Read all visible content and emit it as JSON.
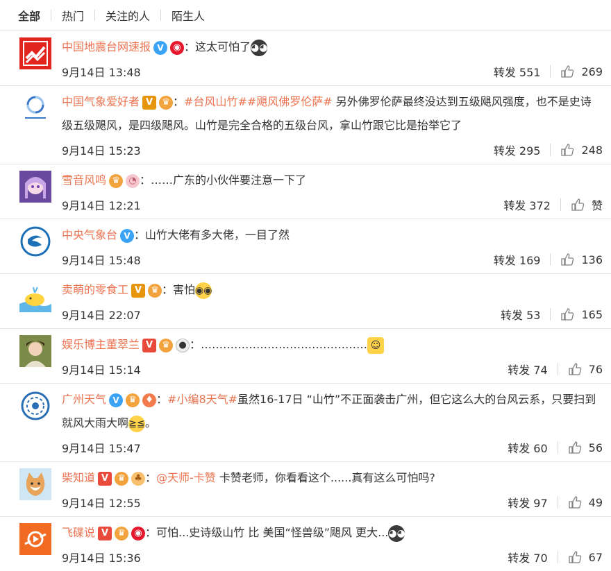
{
  "tabs": [
    "全部",
    "热门",
    "关注的人",
    "陌生人"
  ],
  "comments": [
    {
      "user": "中国地震台网速报",
      "text": "这太可怕了",
      "time": "9月14日 13:48",
      "repost": "转发 551",
      "likes": "269"
    },
    {
      "user": "中国气象爱好者",
      "tag1": "#台风山竹#",
      "tag2": "#飓风佛罗伦萨#",
      "text": " 另外佛罗伦萨最终没达到五级飓风强度，也不是史诗级五级飓风，是四级飓风。山竹是完全合格的五级台风，拿山竹跟它比是抬举它了",
      "time": "9月14日 15:23",
      "repost": "转发 295",
      "likes": "248"
    },
    {
      "user": "雪音风鸣",
      "text": "……广东的小伙伴要注意一下了",
      "time": "9月14日 12:21",
      "repost": "转发 372",
      "likes": "赞"
    },
    {
      "user": "中央气象台",
      "text": "山竹大佬有多大佬，一目了然",
      "time": "9月14日 15:48",
      "repost": "转发 169",
      "likes": "136"
    },
    {
      "user": "卖萌的零食工",
      "text": "害怕",
      "time": "9月14日 22:07",
      "repost": "转发 53",
      "likes": "165"
    },
    {
      "user": "娱乐博主董翠兰",
      "text": "………………………………………",
      "time": "9月14日 15:14",
      "repost": "转发 74",
      "likes": "76"
    },
    {
      "user": "广州天气",
      "tag1": "#小编8天气#",
      "text": "虽然16-17日 “山竹”不正面袭击广州，但它这么大的台风云系，只要扫到就风大雨大啊",
      "text_end": "。",
      "time": "9月14日 15:47",
      "repost": "转发 60",
      "likes": "56"
    },
    {
      "user": "柴知道",
      "mention": "@天师-卡赞",
      "text": " 卡赞老师，你看看这个......真有这么可怕吗?",
      "time": "9月14日 12:55",
      "repost": "转发 97",
      "likes": "49"
    },
    {
      "user": "飞碟说",
      "text": "可怕...史诗级山竹 比 美国“怪兽级”飓风 更大...",
      "time": "9月14日 15:36",
      "repost": "转发 70",
      "likes": "67"
    }
  ],
  "icons": {
    "verified_blue": "V",
    "verified_orange": "V",
    "like": "thumbs-up-icon"
  },
  "colors": {
    "username": "#eb7350",
    "verified_blue": "#3aa3f5",
    "verified_orange": "#e7950c"
  }
}
